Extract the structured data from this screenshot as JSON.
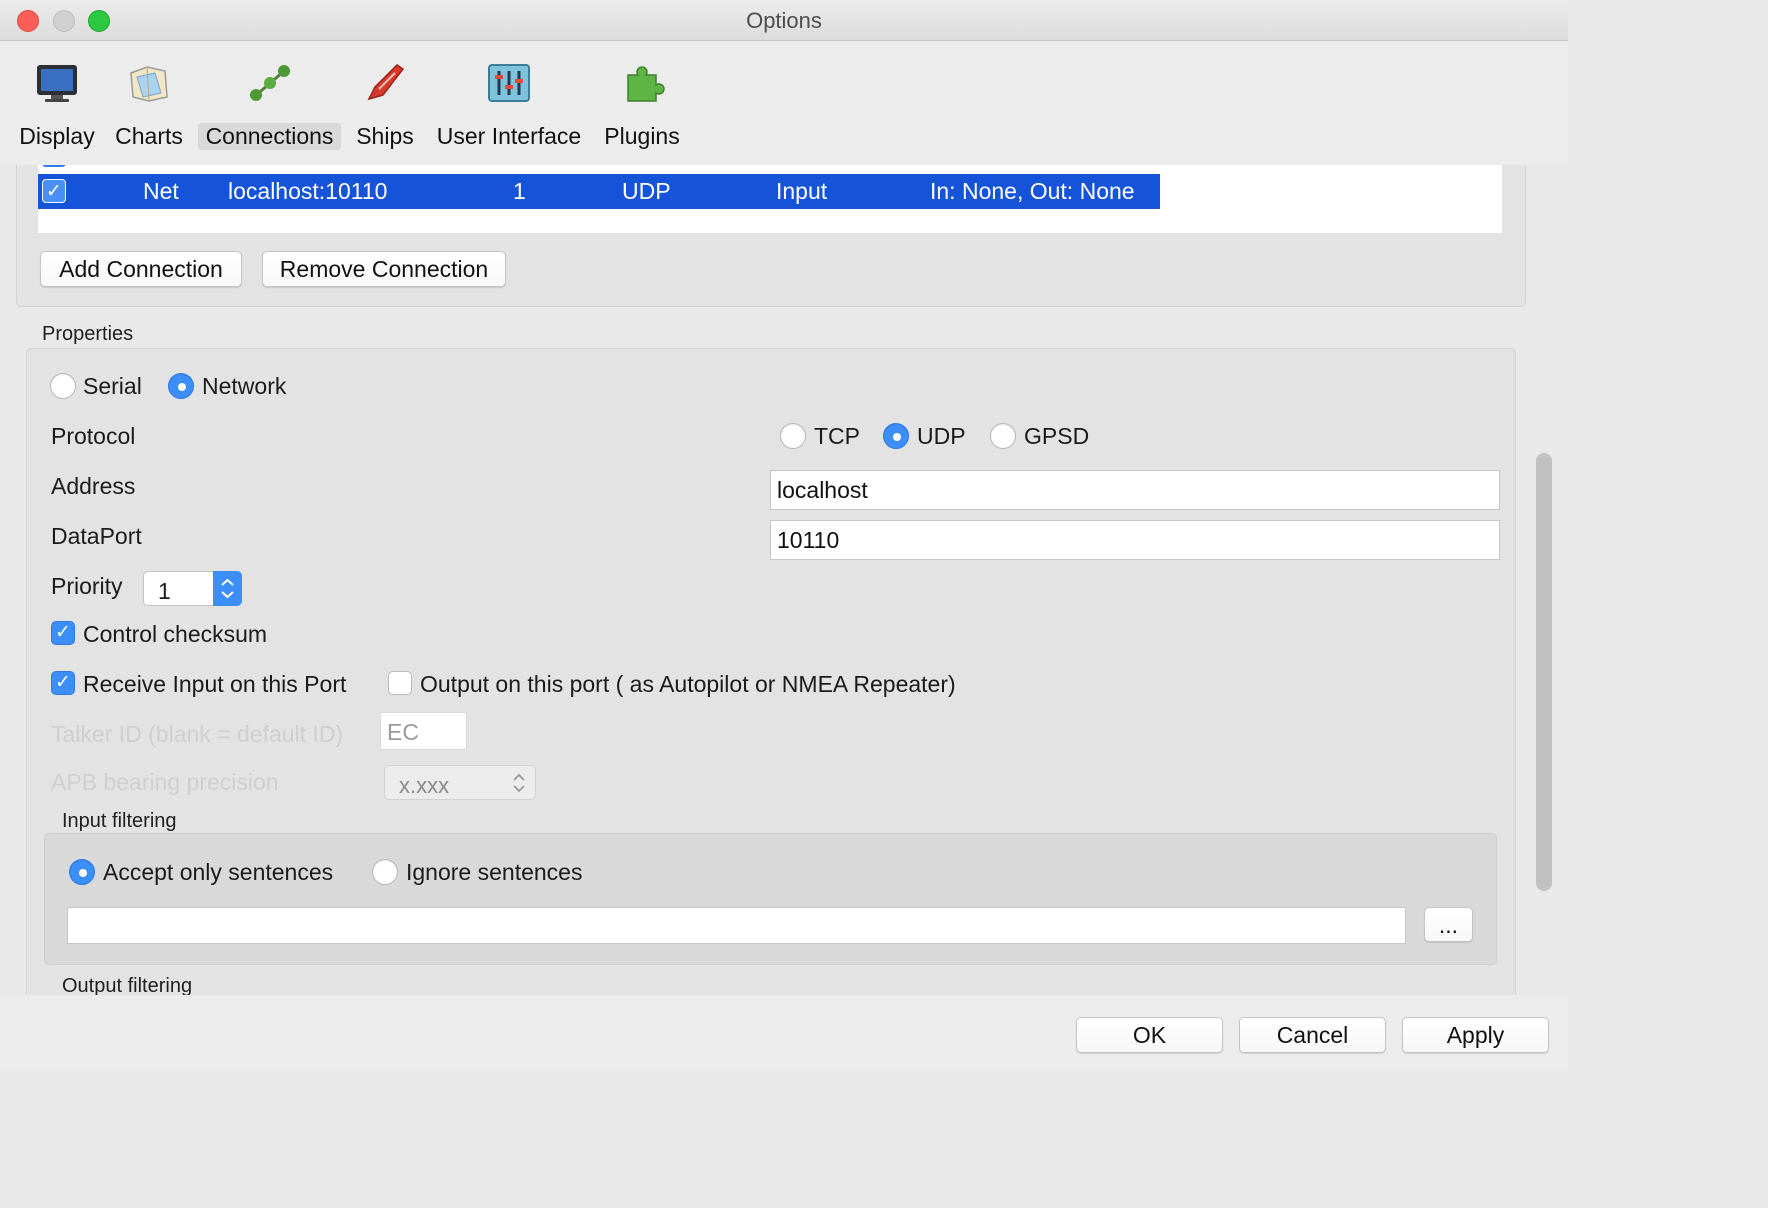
{
  "window": {
    "title": "Options"
  },
  "toolbar": {
    "items": [
      {
        "label": "Display",
        "icon": "display-icon"
      },
      {
        "label": "Charts",
        "icon": "charts-icon"
      },
      {
        "label": "Connections",
        "icon": "connections-icon",
        "active": true
      },
      {
        "label": "Ships",
        "icon": "ships-icon"
      },
      {
        "label": "User Interface",
        "icon": "user-interface-icon"
      },
      {
        "label": "Plugins",
        "icon": "plugins-icon"
      }
    ]
  },
  "connections": {
    "selected_row": {
      "type": "Net",
      "address": "localhost:10110",
      "priority": "1",
      "protocol": "UDP",
      "direction": "Input",
      "filters": "In: None, Out: None",
      "enabled": true
    },
    "add_button": "Add Connection",
    "remove_button": "Remove Connection"
  },
  "properties": {
    "title": "Properties",
    "serial_label": "Serial",
    "network_label": "Network",
    "protocol_label": "Protocol",
    "tcp_label": "TCP",
    "udp_label": "UDP",
    "gpsd_label": "GPSD",
    "address_label": "Address",
    "address_value": "localhost",
    "dataport_label": "DataPort",
    "dataport_value": "10110",
    "priority_label": "Priority",
    "priority_value": "1",
    "control_checksum_label": "Control checksum",
    "receive_input_label": "Receive Input on this Port",
    "output_label": "Output on this port ( as Autopilot or NMEA Repeater)",
    "talker_id_label": "Talker ID (blank = default ID)",
    "talker_id_value": "EC",
    "apb_label": "APB bearing precision",
    "apb_value": "x.xxx"
  },
  "input_filtering": {
    "title": "Input filtering",
    "accept_label": "Accept only sentences",
    "ignore_label": "Ignore sentences",
    "sentences_value": "",
    "browse_label": "..."
  },
  "output_filtering": {
    "title": "Output filtering"
  },
  "dialog": {
    "ok": "OK",
    "cancel": "Cancel",
    "apply": "Apply"
  },
  "colors": {
    "selection": "#1554d9",
    "accent": "#3c8ef8"
  }
}
